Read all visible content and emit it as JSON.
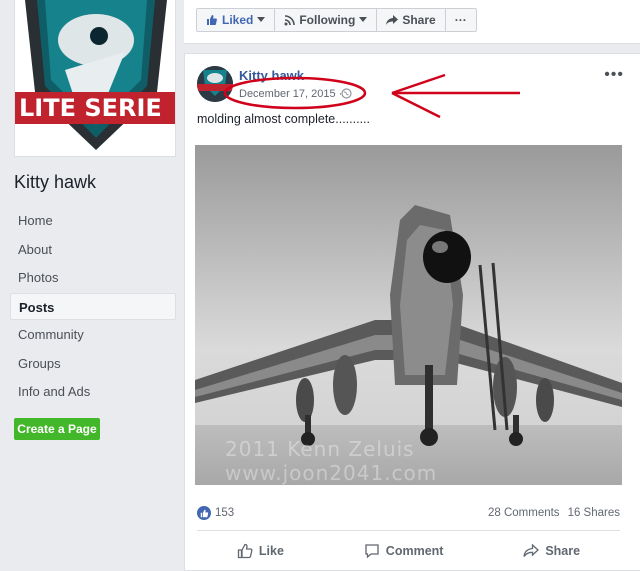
{
  "sidebar": {
    "cover_text": "LITE SERIE",
    "page_name": "Kitty hawk",
    "nav": [
      {
        "label": "Home",
        "active": false
      },
      {
        "label": "About",
        "active": false
      },
      {
        "label": "Photos",
        "active": false
      },
      {
        "label": "Posts",
        "active": true
      },
      {
        "label": "Community",
        "active": false
      },
      {
        "label": "Groups",
        "active": false
      },
      {
        "label": "Info and Ads",
        "active": false
      }
    ],
    "create_page_label": "Create a Page"
  },
  "topbar": {
    "liked_label": "Liked",
    "following_label": "Following",
    "share_label": "Share",
    "more_label": "···"
  },
  "post": {
    "author": "Kitty hawk",
    "date": "December 17, 2015 ·",
    "text": "molding almost complete..........",
    "watermark": "2011 Kenn Zeluis  www.joon2041.com",
    "like_count": "153",
    "comments": "28 Comments",
    "shares": "16 Shares",
    "actions": {
      "like": "Like",
      "comment": "Comment",
      "share": "Share"
    }
  },
  "colors": {
    "brand_blue": "#4267b2",
    "green": "#42b72a",
    "annotation_red": "#d0021b"
  }
}
